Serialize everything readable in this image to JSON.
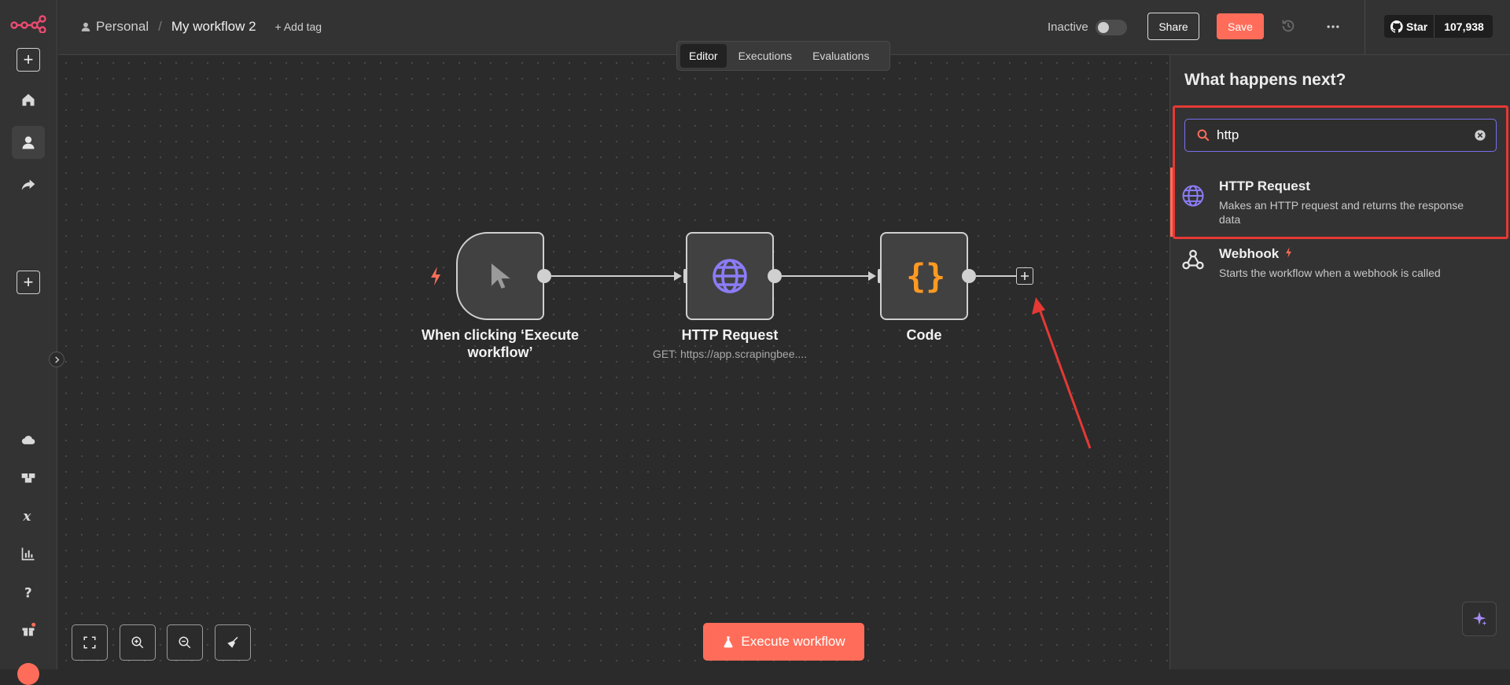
{
  "topbar": {
    "project": "Personal",
    "separator": "/",
    "workflow_name": "My workflow 2",
    "add_tag": "+ Add tag",
    "status_label": "Inactive",
    "share": "Share",
    "save": "Save",
    "star_label": "Star",
    "star_count": "107,938"
  },
  "tabs": [
    "Editor",
    "Executions",
    "Evaluations"
  ],
  "nodes": {
    "trigger": {
      "label_line1": "When clicking ‘Execute",
      "label_line2": "workflow’"
    },
    "http": {
      "label": "HTTP Request",
      "subtitle": "GET: https://app.scrapingbee...."
    },
    "code": {
      "label": "Code"
    }
  },
  "canvas": {
    "execute_button": "Execute workflow"
  },
  "panel": {
    "title": "What happens next?",
    "search_value": "http",
    "results": [
      {
        "title": "HTTP Request",
        "description": "Makes an HTTP request and returns the response data"
      },
      {
        "title": "Webhook",
        "description": "Starts the workflow when a webhook is called"
      }
    ]
  },
  "colors": {
    "accent": "#ff6d5a",
    "highlight": "#e53935",
    "purple": "#7a6ff0",
    "code_orange": "#ff9922"
  }
}
